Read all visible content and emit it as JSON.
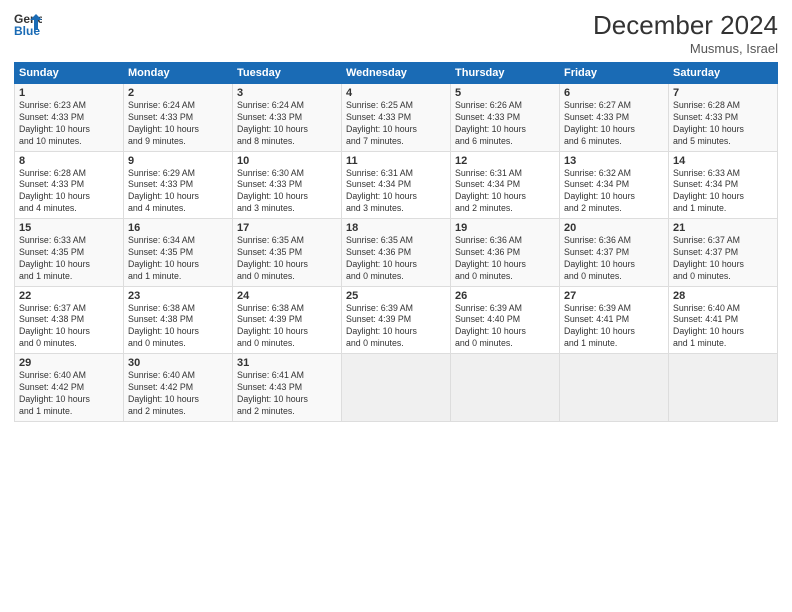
{
  "header": {
    "logo_line1": "General",
    "logo_line2": "Blue",
    "title": "December 2024",
    "location": "Musmus, Israel"
  },
  "days_of_week": [
    "Sunday",
    "Monday",
    "Tuesday",
    "Wednesday",
    "Thursday",
    "Friday",
    "Saturday"
  ],
  "weeks": [
    [
      {
        "day": "1",
        "info": "Sunrise: 6:23 AM\nSunset: 4:33 PM\nDaylight: 10 hours\nand 10 minutes."
      },
      {
        "day": "2",
        "info": "Sunrise: 6:24 AM\nSunset: 4:33 PM\nDaylight: 10 hours\nand 9 minutes."
      },
      {
        "day": "3",
        "info": "Sunrise: 6:24 AM\nSunset: 4:33 PM\nDaylight: 10 hours\nand 8 minutes."
      },
      {
        "day": "4",
        "info": "Sunrise: 6:25 AM\nSunset: 4:33 PM\nDaylight: 10 hours\nand 7 minutes."
      },
      {
        "day": "5",
        "info": "Sunrise: 6:26 AM\nSunset: 4:33 PM\nDaylight: 10 hours\nand 6 minutes."
      },
      {
        "day": "6",
        "info": "Sunrise: 6:27 AM\nSunset: 4:33 PM\nDaylight: 10 hours\nand 6 minutes."
      },
      {
        "day": "7",
        "info": "Sunrise: 6:28 AM\nSunset: 4:33 PM\nDaylight: 10 hours\nand 5 minutes."
      }
    ],
    [
      {
        "day": "8",
        "info": "Sunrise: 6:28 AM\nSunset: 4:33 PM\nDaylight: 10 hours\nand 4 minutes."
      },
      {
        "day": "9",
        "info": "Sunrise: 6:29 AM\nSunset: 4:33 PM\nDaylight: 10 hours\nand 4 minutes."
      },
      {
        "day": "10",
        "info": "Sunrise: 6:30 AM\nSunset: 4:33 PM\nDaylight: 10 hours\nand 3 minutes."
      },
      {
        "day": "11",
        "info": "Sunrise: 6:31 AM\nSunset: 4:34 PM\nDaylight: 10 hours\nand 3 minutes."
      },
      {
        "day": "12",
        "info": "Sunrise: 6:31 AM\nSunset: 4:34 PM\nDaylight: 10 hours\nand 2 minutes."
      },
      {
        "day": "13",
        "info": "Sunrise: 6:32 AM\nSunset: 4:34 PM\nDaylight: 10 hours\nand 2 minutes."
      },
      {
        "day": "14",
        "info": "Sunrise: 6:33 AM\nSunset: 4:34 PM\nDaylight: 10 hours\nand 1 minute."
      }
    ],
    [
      {
        "day": "15",
        "info": "Sunrise: 6:33 AM\nSunset: 4:35 PM\nDaylight: 10 hours\nand 1 minute."
      },
      {
        "day": "16",
        "info": "Sunrise: 6:34 AM\nSunset: 4:35 PM\nDaylight: 10 hours\nand 1 minute."
      },
      {
        "day": "17",
        "info": "Sunrise: 6:35 AM\nSunset: 4:35 PM\nDaylight: 10 hours\nand 0 minutes."
      },
      {
        "day": "18",
        "info": "Sunrise: 6:35 AM\nSunset: 4:36 PM\nDaylight: 10 hours\nand 0 minutes."
      },
      {
        "day": "19",
        "info": "Sunrise: 6:36 AM\nSunset: 4:36 PM\nDaylight: 10 hours\nand 0 minutes."
      },
      {
        "day": "20",
        "info": "Sunrise: 6:36 AM\nSunset: 4:37 PM\nDaylight: 10 hours\nand 0 minutes."
      },
      {
        "day": "21",
        "info": "Sunrise: 6:37 AM\nSunset: 4:37 PM\nDaylight: 10 hours\nand 0 minutes."
      }
    ],
    [
      {
        "day": "22",
        "info": "Sunrise: 6:37 AM\nSunset: 4:38 PM\nDaylight: 10 hours\nand 0 minutes."
      },
      {
        "day": "23",
        "info": "Sunrise: 6:38 AM\nSunset: 4:38 PM\nDaylight: 10 hours\nand 0 minutes."
      },
      {
        "day": "24",
        "info": "Sunrise: 6:38 AM\nSunset: 4:39 PM\nDaylight: 10 hours\nand 0 minutes."
      },
      {
        "day": "25",
        "info": "Sunrise: 6:39 AM\nSunset: 4:39 PM\nDaylight: 10 hours\nand 0 minutes."
      },
      {
        "day": "26",
        "info": "Sunrise: 6:39 AM\nSunset: 4:40 PM\nDaylight: 10 hours\nand 0 minutes."
      },
      {
        "day": "27",
        "info": "Sunrise: 6:39 AM\nSunset: 4:41 PM\nDaylight: 10 hours\nand 1 minute."
      },
      {
        "day": "28",
        "info": "Sunrise: 6:40 AM\nSunset: 4:41 PM\nDaylight: 10 hours\nand 1 minute."
      }
    ],
    [
      {
        "day": "29",
        "info": "Sunrise: 6:40 AM\nSunset: 4:42 PM\nDaylight: 10 hours\nand 1 minute."
      },
      {
        "day": "30",
        "info": "Sunrise: 6:40 AM\nSunset: 4:42 PM\nDaylight: 10 hours\nand 2 minutes."
      },
      {
        "day": "31",
        "info": "Sunrise: 6:41 AM\nSunset: 4:43 PM\nDaylight: 10 hours\nand 2 minutes."
      },
      null,
      null,
      null,
      null
    ]
  ]
}
